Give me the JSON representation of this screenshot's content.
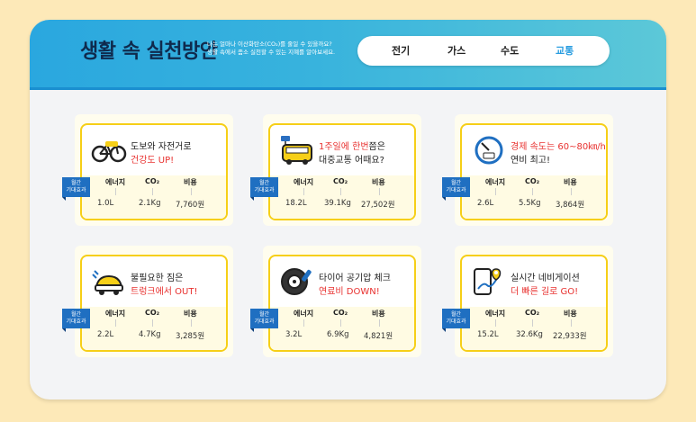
{
  "header": {
    "title": "생활 속 실천방안",
    "subtitle_1": "나는 얼마나 이산화탄소(CO₂)를 줄일 수 있을까요?",
    "subtitle_2": "생활 속에서 좀소 실천할 수 있는 지혜를 알아보세요."
  },
  "tabs": [
    {
      "label": "전기"
    },
    {
      "label": "가스"
    },
    {
      "label": "수도"
    },
    {
      "label": "교통",
      "active": true
    }
  ],
  "labels": {
    "badge_line1": "월간",
    "badge_line2": "기대효과",
    "energy": "에너지",
    "co2": "CO₂",
    "cost": "비용"
  },
  "cards": [
    {
      "icon": "bicycle-icon",
      "line1_a": "도보와 자전거로",
      "line1_b": "",
      "line2_a": "건강도 UP!",
      "line2_b": "",
      "line1_red_first": false,
      "line2_red": true,
      "energy": "1.0L",
      "co2": "2.1Kg",
      "cost": "7,760원"
    },
    {
      "icon": "bus-icon",
      "line1_a": "1주일에 한번",
      "line1_b": "쯤은",
      "line2_a": "대중교통 어때요?",
      "line2_b": "",
      "line1_red_first": true,
      "line2_red": false,
      "energy": "18.2L",
      "co2": "39.1Kg",
      "cost": "27,502원"
    },
    {
      "icon": "speedometer-icon",
      "line1_a": "경제 속도는 60~80㎞/h",
      "line1_b": "",
      "line2_a": "연비 최고!",
      "line2_b": "",
      "line1_red_first": true,
      "line2_red": false,
      "energy": "2.6L",
      "co2": "5.5Kg",
      "cost": "3,864원"
    },
    {
      "icon": "car-trunk-icon",
      "line1_a": "불필요한 짐은",
      "line1_b": "",
      "line2_a": "트렁크에서 OUT!",
      "line2_b": "",
      "line1_red_first": false,
      "line2_red": true,
      "energy": "2.2L",
      "co2": "4.7Kg",
      "cost": "3,285원"
    },
    {
      "icon": "tire-icon",
      "line1_a": "타이어 공기압 체크",
      "line1_b": "",
      "line2_a": "연료비 DOWN!",
      "line2_b": "",
      "line1_red_first": false,
      "line2_red": true,
      "energy": "3.2L",
      "co2": "6.9Kg",
      "cost": "4,821원"
    },
    {
      "icon": "navigation-icon",
      "line1_a": "실시간 네비게이션",
      "line1_b": "",
      "line2_a": "더 빠른 길로 GO!",
      "line2_b": "",
      "line1_red_first": false,
      "line2_red": true,
      "energy": "15.2L",
      "co2": "32.6Kg",
      "cost": "22,933원"
    }
  ],
  "colors": {
    "accent": "#f6cf17",
    "red": "#e8312f",
    "blue": "#1f6fc1"
  }
}
